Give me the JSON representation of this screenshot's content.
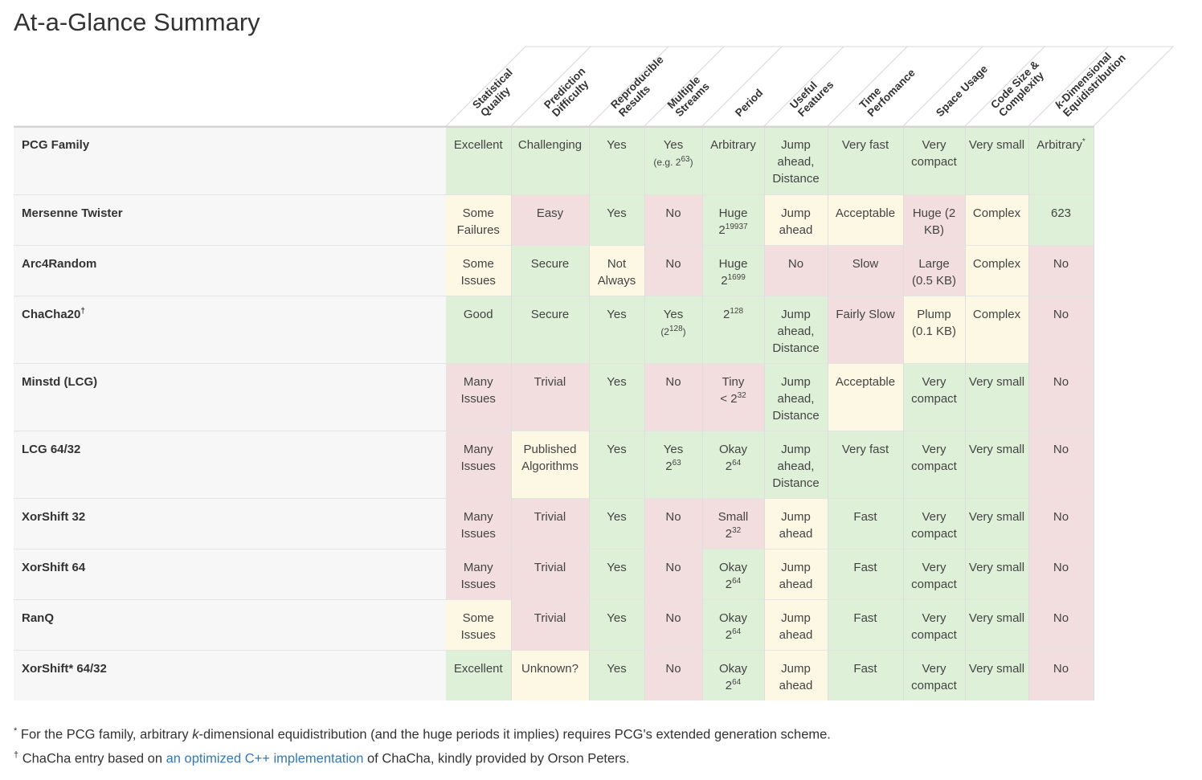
{
  "page": {
    "title": "At-a-Glance Summary"
  },
  "columns": [
    [
      "Statistical",
      "Quality"
    ],
    [
      "Prediction",
      "Difficulty"
    ],
    [
      "Reproducible",
      "Results"
    ],
    [
      "Multiple",
      "Streams"
    ],
    [
      "Period"
    ],
    [
      "Useful",
      "Features"
    ],
    [
      "Time",
      "Perfomance"
    ],
    [
      "Space Usage"
    ],
    [
      "Code Size &",
      "Complexity"
    ],
    [
      "k-Dimensional",
      "Equidistribution"
    ]
  ],
  "rows": [
    {
      "name": "PCG Family",
      "h": 84,
      "cells": [
        {
          "t": "Excellent",
          "c": "g"
        },
        {
          "t": "Challenging",
          "c": "g"
        },
        {
          "t": "Yes",
          "c": "g"
        },
        {
          "t": "Yes",
          "small": "(e.g. 2",
          "sup": "63",
          "tail": ")",
          "c": "g"
        },
        {
          "t": "Arbitrary",
          "c": "g"
        },
        {
          "t": "Jump ahead, Distance",
          "c": "g"
        },
        {
          "t": "Very fast",
          "c": "g"
        },
        {
          "t": "Very compact",
          "c": "g"
        },
        {
          "t": "Very small",
          "c": "g"
        },
        {
          "t": "Arbitrary",
          "sup": "*",
          "c": "g"
        }
      ]
    },
    {
      "name": "Mersenne Twister",
      "h": 63,
      "cells": [
        {
          "t": "Some Failures",
          "c": "y"
        },
        {
          "t": "Easy",
          "c": "r"
        },
        {
          "t": "Yes",
          "c": "g"
        },
        {
          "t": "No",
          "c": "r"
        },
        {
          "t": "Huge",
          "line2": "2",
          "sup": "19937",
          "c": "g"
        },
        {
          "t": "Jump ahead",
          "c": "y"
        },
        {
          "t": "Acceptable",
          "c": "y"
        },
        {
          "t": "Huge (2 KB)",
          "c": "r"
        },
        {
          "t": "Complex",
          "c": "y"
        },
        {
          "t": "623",
          "c": "g"
        }
      ]
    },
    {
      "name": "Arc4Random",
      "h": 63,
      "cells": [
        {
          "t": "Some Issues",
          "c": "y"
        },
        {
          "t": "Secure",
          "c": "g"
        },
        {
          "t": "Not Always",
          "c": "y"
        },
        {
          "t": "No",
          "c": "r"
        },
        {
          "t": "Huge",
          "line2": "2",
          "sup": "1699",
          "c": "g"
        },
        {
          "t": "No",
          "c": "r"
        },
        {
          "t": "Slow",
          "c": "r"
        },
        {
          "t": "Large (0.5 KB)",
          "c": "r"
        },
        {
          "t": "Complex",
          "c": "y"
        },
        {
          "t": "No",
          "c": "r"
        }
      ]
    },
    {
      "name": "ChaCha20",
      "namesup": "†",
      "h": 84,
      "cells": [
        {
          "t": "Good",
          "c": "g"
        },
        {
          "t": "Secure",
          "c": "g"
        },
        {
          "t": "Yes",
          "c": "g"
        },
        {
          "t": "Yes",
          "small": "(2",
          "sup": "128",
          "tail": ")",
          "c": "g"
        },
        {
          "t": "2",
          "sup": "128",
          "c": "g"
        },
        {
          "t": "Jump ahead, Distance",
          "c": "g"
        },
        {
          "t": "Fairly Slow",
          "c": "r"
        },
        {
          "t": "Plump (0.1 KB)",
          "c": "y"
        },
        {
          "t": "Complex",
          "c": "y"
        },
        {
          "t": "No",
          "c": "r"
        }
      ]
    },
    {
      "name": "Minstd (LCG)",
      "h": 84,
      "cells": [
        {
          "t": "Many Issues",
          "c": "r"
        },
        {
          "t": "Trivial",
          "c": "r"
        },
        {
          "t": "Yes",
          "c": "g"
        },
        {
          "t": "No",
          "c": "r"
        },
        {
          "t": "Tiny",
          "line2": "< 2",
          "sup": "32",
          "c": "r"
        },
        {
          "t": "Jump ahead, Distance",
          "c": "g"
        },
        {
          "t": "Acceptable",
          "c": "y"
        },
        {
          "t": "Very compact",
          "c": "g"
        },
        {
          "t": "Very small",
          "c": "g"
        },
        {
          "t": "No",
          "c": "r"
        }
      ]
    },
    {
      "name": "LCG 64/32",
      "h": 84,
      "cells": [
        {
          "t": "Many Issues",
          "c": "r"
        },
        {
          "t": "Published Algorithms",
          "c": "y"
        },
        {
          "t": "Yes",
          "c": "g"
        },
        {
          "t": "Yes",
          "line2": "2",
          "sup": "63",
          "c": "g"
        },
        {
          "t": "Okay",
          "line2": "2",
          "sup": "64",
          "c": "g"
        },
        {
          "t": "Jump ahead, Distance",
          "c": "g"
        },
        {
          "t": "Very fast",
          "c": "g"
        },
        {
          "t": "Very compact",
          "c": "g"
        },
        {
          "t": "Very small",
          "c": "g"
        },
        {
          "t": "No",
          "c": "r"
        }
      ]
    },
    {
      "name": "XorShift 32",
      "h": 63,
      "cells": [
        {
          "t": "Many Issues",
          "c": "r"
        },
        {
          "t": "Trivial",
          "c": "r"
        },
        {
          "t": "Yes",
          "c": "g"
        },
        {
          "t": "No",
          "c": "r"
        },
        {
          "t": "Small",
          "line2": "2",
          "sup": "32",
          "c": "r"
        },
        {
          "t": "Jump ahead",
          "c": "y"
        },
        {
          "t": "Fast",
          "c": "g"
        },
        {
          "t": "Very compact",
          "c": "g"
        },
        {
          "t": "Very small",
          "c": "g"
        },
        {
          "t": "No",
          "c": "r"
        }
      ]
    },
    {
      "name": "XorShift 64",
      "h": 63,
      "cells": [
        {
          "t": "Many Issues",
          "c": "r"
        },
        {
          "t": "Trivial",
          "c": "r"
        },
        {
          "t": "Yes",
          "c": "g"
        },
        {
          "t": "No",
          "c": "r"
        },
        {
          "t": "Okay",
          "line2": "2",
          "sup": "64",
          "c": "g"
        },
        {
          "t": "Jump ahead",
          "c": "y"
        },
        {
          "t": "Fast",
          "c": "g"
        },
        {
          "t": "Very compact",
          "c": "g"
        },
        {
          "t": "Very small",
          "c": "g"
        },
        {
          "t": "No",
          "c": "r"
        }
      ]
    },
    {
      "name": "RanQ",
      "h": 63,
      "cells": [
        {
          "t": "Some Issues",
          "c": "y"
        },
        {
          "t": "Trivial",
          "c": "r"
        },
        {
          "t": "Yes",
          "c": "g"
        },
        {
          "t": "No",
          "c": "r"
        },
        {
          "t": "Okay",
          "line2": "2",
          "sup": "64",
          "c": "g"
        },
        {
          "t": "Jump ahead",
          "c": "y"
        },
        {
          "t": "Fast",
          "c": "g"
        },
        {
          "t": "Very compact",
          "c": "g"
        },
        {
          "t": "Very small",
          "c": "g"
        },
        {
          "t": "No",
          "c": "r"
        }
      ]
    },
    {
      "name": "XorShift* 64/32",
      "h": 63,
      "cells": [
        {
          "t": "Excellent",
          "c": "g"
        },
        {
          "t": "Unknown?",
          "c": "y"
        },
        {
          "t": "Yes",
          "c": "g"
        },
        {
          "t": "No",
          "c": "r"
        },
        {
          "t": "Okay",
          "line2": "2",
          "sup": "64",
          "c": "g"
        },
        {
          "t": "Jump ahead",
          "c": "y"
        },
        {
          "t": "Fast",
          "c": "g"
        },
        {
          "t": "Very compact",
          "c": "g"
        },
        {
          "t": "Very small",
          "c": "g"
        },
        {
          "t": "No",
          "c": "r"
        }
      ]
    }
  ],
  "footnotes": {
    "star_mark": "*",
    "star_text_before": " For the PCG family, arbitrary ",
    "star_italic": "k",
    "star_text_after": "-dimensional equidistribution (and the huge periods it implies) requires PCG's extended generation scheme.",
    "dagger_mark": "†",
    "dagger_text_before": " ChaCha entry based on ",
    "dagger_link": "an optimized C++ implementation",
    "dagger_text_after": " of ChaCha, kindly provided by Orson Peters."
  },
  "colors": {
    "good": "#dff0d8",
    "bad": "#f2dede",
    "warn": "#fcf8e3",
    "link": "#3379b7"
  }
}
